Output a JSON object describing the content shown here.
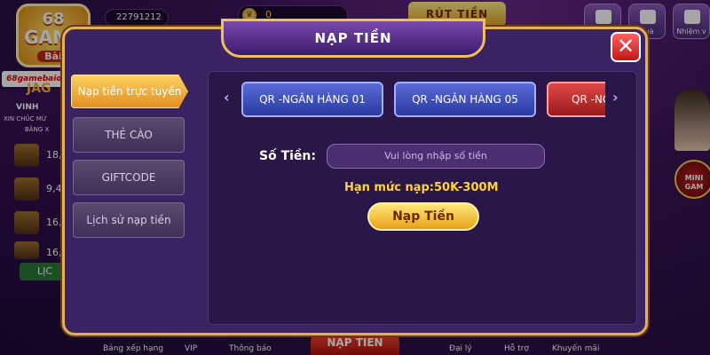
{
  "app": {
    "logo_top": "68",
    "logo_game": "GAME",
    "logo_sub": "Bài",
    "site": "68gamebaionline.net"
  },
  "topbar": {
    "user_id": "22791212",
    "coins": "0",
    "withdraw": "RÚT TIỀN",
    "icons": [
      {
        "label": ""
      },
      {
        "label": "quà"
      },
      {
        "label": "Nhiệm v"
      }
    ]
  },
  "left_panel": {
    "jackpot": "JAG",
    "vinh": "VINH",
    "line1": "XIN CHÚC MỪ",
    "line2": "BẢNG X",
    "values": [
      "18,6",
      "9,4",
      "16,3",
      "16,0"
    ],
    "button": "LỊC"
  },
  "right_panel": {
    "mini": "MINI GAM"
  },
  "bottombar": {
    "items": [
      "Bảng xếp hạng",
      "VIP",
      "Thông báo",
      "Đại lý",
      "Hỗ trợ",
      "Khuyến mãi"
    ],
    "center": "NẠP TIỀN"
  },
  "modal": {
    "title": "NẠP TIỀN",
    "close": "✕",
    "nav": [
      "Nạp tiền trực tuyến",
      "THẺ CÀO",
      "GIFTCODE",
      "Lịch sử nạp tiền"
    ],
    "banks": [
      "QR -NGÂN HÀNG 01",
      "QR -NGÂN HÀNG 05",
      "QR -NG"
    ],
    "amount_label": "Số Tiền:",
    "amount_placeholder": "Vui lòng nhập số tiền",
    "limit": "Hạn mức nạp:50K-300M",
    "submit": "Nạp Tiền",
    "arrow_left": "‹",
    "arrow_right": "›"
  },
  "colors": {
    "accent": "#ffd430",
    "modal_bg": "#3b2260",
    "bank_blue": "#3a4ac0",
    "bank_red": "#c02828"
  }
}
